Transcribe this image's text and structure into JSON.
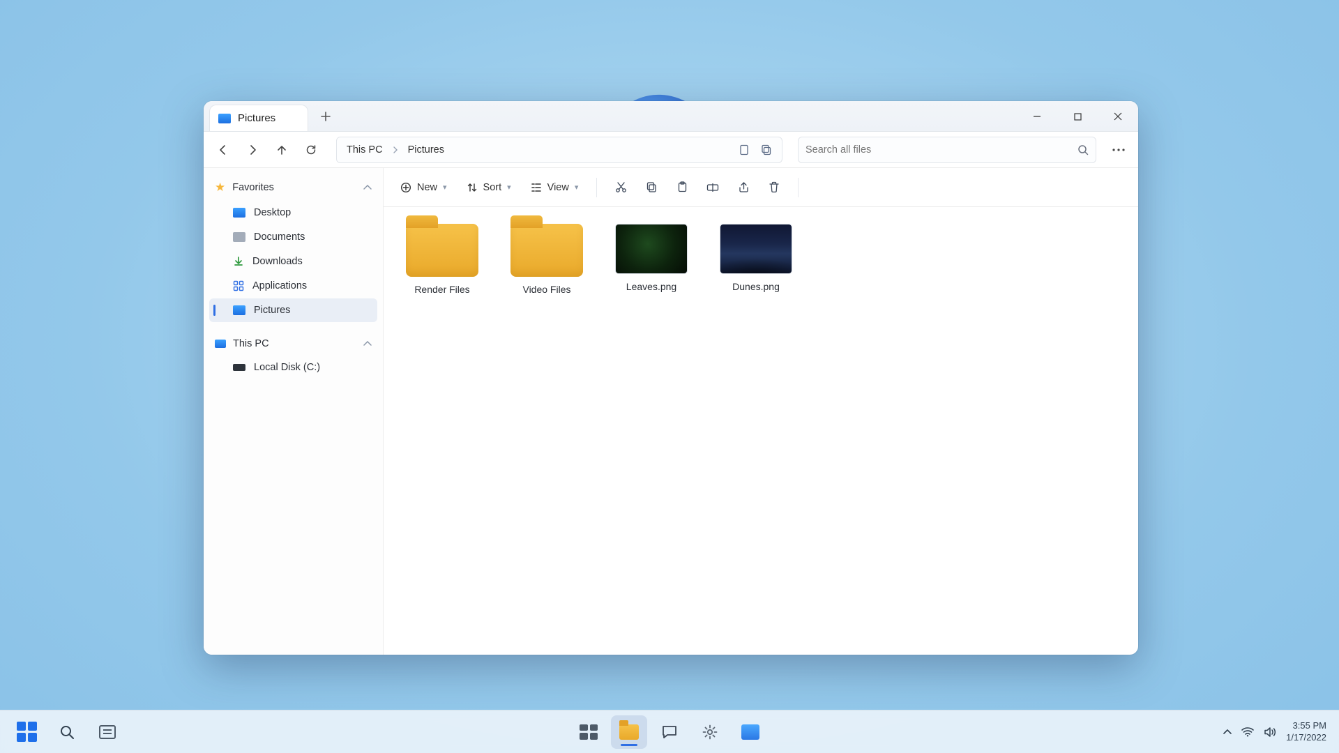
{
  "window": {
    "tab_title": "Pictures",
    "breadcrumbs": [
      "This PC",
      "Pictures"
    ],
    "search_placeholder": "Search all files"
  },
  "cmdbar": {
    "new": "New",
    "sort": "Sort",
    "view": "View"
  },
  "sidebar": {
    "favorites_label": "Favorites",
    "items": [
      {
        "label": "Desktop"
      },
      {
        "label": "Documents"
      },
      {
        "label": "Downloads"
      },
      {
        "label": "Applications"
      },
      {
        "label": "Pictures"
      }
    ],
    "thispc_label": "This PC",
    "drives": [
      {
        "label": "Local Disk (C:)"
      }
    ]
  },
  "files": [
    {
      "name": "Render Files",
      "type": "folder"
    },
    {
      "name": "Video Files",
      "type": "folder"
    },
    {
      "name": "Leaves.png",
      "type": "image",
      "thumb": "leaves"
    },
    {
      "name": "Dunes.png",
      "type": "image",
      "thumb": "dunes"
    }
  ],
  "systray": {
    "time": "3:55 PM",
    "date": "1/17/2022"
  }
}
